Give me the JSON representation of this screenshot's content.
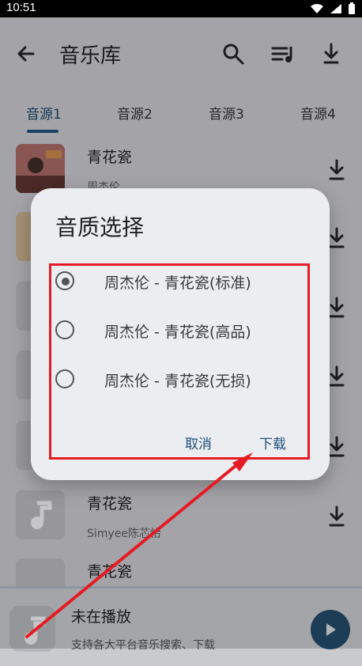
{
  "status_bar": {
    "time": "10:51"
  },
  "header": {
    "title": "音乐库"
  },
  "tabs": [
    {
      "label": "音源1"
    },
    {
      "label": "音源2"
    },
    {
      "label": "音源3"
    },
    {
      "label": "音源4"
    }
  ],
  "songs": [
    {
      "title": "青花瓷",
      "artist": "周杰伦"
    },
    {
      "title": "",
      "artist": ""
    },
    {
      "title": "",
      "artist": ""
    },
    {
      "title": "",
      "artist": ""
    },
    {
      "title": "",
      "artist": ""
    },
    {
      "title": "青花瓷",
      "artist": "Simyee陈芯怡"
    },
    {
      "title": "青花瓷",
      "artist": ""
    }
  ],
  "player": {
    "title": "未在播放",
    "subtitle": "支持各大平台音乐搜索、下载"
  },
  "dialog": {
    "title": "音质选择",
    "options": [
      {
        "label": "周杰伦 - 青花瓷(标准)",
        "selected": true
      },
      {
        "label": "周杰伦 - 青花瓷(高品)",
        "selected": false
      },
      {
        "label": "周杰伦 - 青花瓷(无损)",
        "selected": false
      }
    ],
    "cancel_label": "取消",
    "confirm_label": "下载"
  },
  "colors": {
    "accent": "#1f5077",
    "annotation_red": "#e51b23"
  }
}
